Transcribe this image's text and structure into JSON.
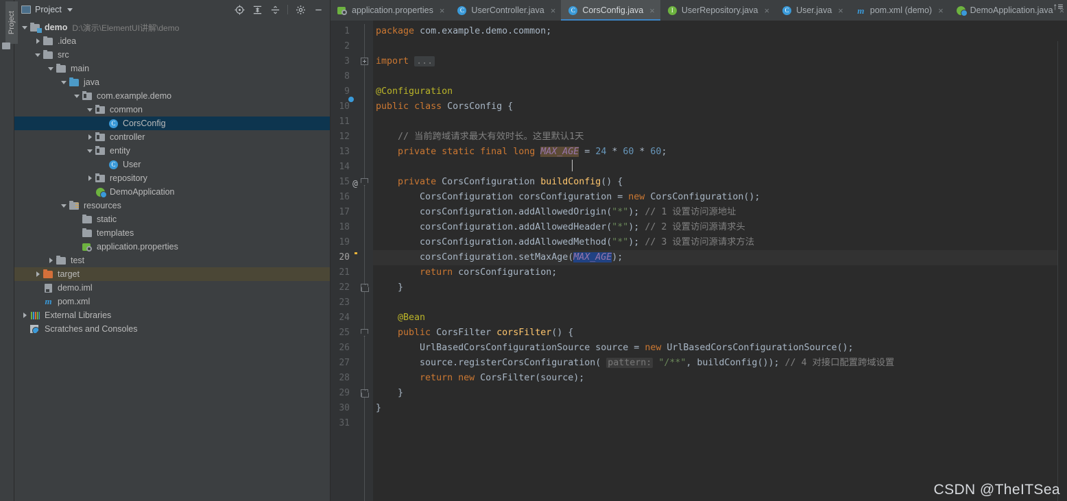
{
  "tool_strip": {
    "label": "Project"
  },
  "project_panel": {
    "title": "Project",
    "actions": [
      {
        "name": "locate-icon",
        "glyph": "⊕"
      },
      {
        "name": "expand-all-icon",
        "glyph": "≡"
      },
      {
        "name": "collapse-all-icon",
        "glyph": "≡"
      },
      {
        "name": "settings-gear-icon",
        "glyph": "⚙"
      },
      {
        "name": "minimize-icon",
        "glyph": "—"
      }
    ],
    "tree": [
      {
        "label": "demo",
        "path": "D:\\演示\\ElementUI讲解\\demo",
        "indent": 0,
        "arrow": "down",
        "icon": "module",
        "bold": true
      },
      {
        "label": ".idea",
        "indent": 1,
        "arrow": "right",
        "icon": "folder"
      },
      {
        "label": "src",
        "indent": 1,
        "arrow": "down",
        "icon": "folder"
      },
      {
        "label": "main",
        "indent": 2,
        "arrow": "down",
        "icon": "folder"
      },
      {
        "label": "java",
        "indent": 3,
        "arrow": "down",
        "icon": "folder-src"
      },
      {
        "label": "com.example.demo",
        "indent": 4,
        "arrow": "down",
        "icon": "package"
      },
      {
        "label": "common",
        "indent": 5,
        "arrow": "down",
        "icon": "package"
      },
      {
        "label": "CorsConfig",
        "indent": 6,
        "arrow": "none",
        "icon": "class",
        "selected": true
      },
      {
        "label": "controller",
        "indent": 5,
        "arrow": "right",
        "icon": "package"
      },
      {
        "label": "entity",
        "indent": 5,
        "arrow": "down",
        "icon": "package"
      },
      {
        "label": "User",
        "indent": 6,
        "arrow": "none",
        "icon": "class"
      },
      {
        "label": "repository",
        "indent": 5,
        "arrow": "right",
        "icon": "package"
      },
      {
        "label": "DemoApplication",
        "indent": 5,
        "arrow": "none",
        "icon": "spring-app"
      },
      {
        "label": "resources",
        "indent": 3,
        "arrow": "down",
        "icon": "folder-res"
      },
      {
        "label": "static",
        "indent": 4,
        "arrow": "none",
        "icon": "folder"
      },
      {
        "label": "templates",
        "indent": 4,
        "arrow": "none",
        "icon": "folder"
      },
      {
        "label": "application.properties",
        "indent": 4,
        "arrow": "none",
        "icon": "properties"
      },
      {
        "label": "test",
        "indent": 2,
        "arrow": "right",
        "icon": "folder"
      },
      {
        "label": "target",
        "indent": 1,
        "arrow": "right",
        "icon": "folder-target",
        "highlight": true
      },
      {
        "label": "demo.iml",
        "indent": 1,
        "arrow": "none",
        "icon": "iml"
      },
      {
        "label": "pom.xml",
        "indent": 1,
        "arrow": "none",
        "icon": "maven"
      },
      {
        "label": "External Libraries",
        "indent": 0,
        "arrow": "right",
        "icon": "libraries"
      },
      {
        "label": "Scratches and Consoles",
        "indent": 0,
        "arrow": "none",
        "icon": "scratches"
      }
    ]
  },
  "editor": {
    "tabs": [
      {
        "label": "application.properties",
        "icon": "properties-icon",
        "active": false,
        "close": "×"
      },
      {
        "label": "UserController.java",
        "icon": "class-icon",
        "active": false,
        "close": "×"
      },
      {
        "label": "CorsConfig.java",
        "icon": "class-icon",
        "active": true,
        "close": "×"
      },
      {
        "label": "UserRepository.java",
        "icon": "interface-icon",
        "active": false,
        "close": "×"
      },
      {
        "label": "User.java",
        "icon": "class-icon",
        "active": false,
        "close": "×"
      },
      {
        "label": "pom.xml (demo)",
        "icon": "maven-icon",
        "active": false,
        "close": "×"
      },
      {
        "label": "DemoApplication.java",
        "icon": "spring-icon",
        "active": false,
        "close": "×"
      }
    ],
    "tabbar_overflow": "↑≡",
    "current_line": 20,
    "lines": [
      {
        "n": "1",
        "gutter": "",
        "fold": "",
        "html": "<span class=\"kw\">package</span> <span class=\"id\">com.example.demo.common</span><span class=\"id\">;</span>"
      },
      {
        "n": "2",
        "gutter": "",
        "fold": "",
        "html": ""
      },
      {
        "n": "3",
        "gutter": "",
        "fold": "plus",
        "html": "<span class=\"kw\">import</span> <span class=\"fold-dots\">...</span>"
      },
      {
        "n": "8",
        "gutter": "",
        "fold": "",
        "html": ""
      },
      {
        "n": "9",
        "gutter": "",
        "fold": "",
        "html": "<span class=\"ann\">@Configuration</span>"
      },
      {
        "n": "10",
        "gutter": "spring",
        "fold": "",
        "html": "<span class=\"kw\">public</span> <span class=\"kw\">class</span> <span class=\"id\">CorsConfig</span> {"
      },
      {
        "n": "11",
        "gutter": "",
        "fold": "",
        "html": ""
      },
      {
        "n": "12",
        "gutter": "",
        "fold": "",
        "html": "    <span class=\"cmt\">// 当前跨域请求最大有效时长。这里默认1天</span>"
      },
      {
        "n": "13",
        "gutter": "",
        "fold": "",
        "html": "    <span class=\"kw\">private</span> <span class=\"kw\">static</span> <span class=\"kw\">final</span> <span class=\"kw\">long</span> <span class=\"const-mark\">MAX_AGE</span> = <span class=\"num2\">24</span> * <span class=\"num2\">60</span> * <span class=\"num2\">60</span>;"
      },
      {
        "n": "14",
        "gutter": "",
        "fold": "",
        "html": ""
      },
      {
        "n": "15",
        "gutter": "at",
        "fold": "tri-down",
        "html": "    <span class=\"kw\">private</span> <span class=\"id\">CorsConfiguration</span> <span class=\"fn\">buildConfig</span>() {"
      },
      {
        "n": "16",
        "gutter": "",
        "fold": "",
        "html": "        <span class=\"id\">CorsConfiguration</span> <span class=\"id\">corsConfiguration</span> = <span class=\"kw\">new</span> <span class=\"id\">CorsConfiguration</span>();"
      },
      {
        "n": "17",
        "gutter": "",
        "fold": "",
        "html": "        <span class=\"id\">corsConfiguration</span>.<span class=\"id\">addAllowedOrigin</span>(<span class=\"str\">\"*\"</span>); <span class=\"cmt\">// 1 设置访问源地址</span>"
      },
      {
        "n": "18",
        "gutter": "",
        "fold": "",
        "html": "        <span class=\"id\">corsConfiguration</span>.<span class=\"id\">addAllowedHeader</span>(<span class=\"str\">\"*\"</span>); <span class=\"cmt\">// 2 设置访问源请求头</span>"
      },
      {
        "n": "19",
        "gutter": "",
        "fold": "",
        "html": "        <span class=\"id\">corsConfiguration</span>.<span class=\"id\">addAllowedMethod</span>(<span class=\"str\">\"*\"</span>); <span class=\"cmt\">// 3 设置访问源请求方法</span>"
      },
      {
        "n": "20",
        "gutter": "bulb",
        "fold": "",
        "html": "        <span class=\"id\">corsConfiguration</span>.<span class=\"id\">setMaxAge</span>(<span class=\"const-hl\">MAX_AGE</span>);",
        "current": true
      },
      {
        "n": "21",
        "gutter": "",
        "fold": "",
        "html": "        <span class=\"kw\">return</span> <span class=\"id\">corsConfiguration</span>;"
      },
      {
        "n": "22",
        "gutter": "",
        "fold": "tri-up",
        "html": "    }"
      },
      {
        "n": "23",
        "gutter": "",
        "fold": "",
        "html": ""
      },
      {
        "n": "24",
        "gutter": "bean",
        "fold": "",
        "html": "    <span class=\"ann\">@Bean</span>"
      },
      {
        "n": "25",
        "gutter": "",
        "fold": "tri-down",
        "html": "    <span class=\"kw\">public</span> <span class=\"id\">CorsFilter</span> <span class=\"fn\">corsFilter</span>() {"
      },
      {
        "n": "26",
        "gutter": "",
        "fold": "",
        "html": "        <span class=\"id\">UrlBasedCorsConfigurationSource</span> <span class=\"id\">source</span> = <span class=\"kw\">new</span> <span class=\"id\">UrlBasedCorsConfigurationSource</span>();"
      },
      {
        "n": "27",
        "gutter": "",
        "fold": "",
        "html": "        <span class=\"id\">source</span>.<span class=\"id\">registerCorsConfiguration</span>( <span class=\"hint\">pattern:</span> <span class=\"str\">\"/**\"</span>, <span class=\"id\">buildConfig</span>()); <span class=\"cmt\">// 4 对接口配置跨域设置</span>"
      },
      {
        "n": "28",
        "gutter": "",
        "fold": "",
        "html": "        <span class=\"kw\">return</span> <span class=\"kw\">new</span> <span class=\"id\">CorsFilter</span>(<span class=\"id\">source</span>);"
      },
      {
        "n": "29",
        "gutter": "",
        "fold": "tri-up",
        "html": "    }"
      },
      {
        "n": "30",
        "gutter": "",
        "fold": "",
        "html": "}"
      },
      {
        "n": "31",
        "gutter": "",
        "fold": "",
        "html": ""
      }
    ]
  },
  "watermark": {
    "text": "CSDN @TheITSea"
  },
  "colors": {
    "panel_bg": "#3c3f41",
    "editor_bg": "#2b2b2b",
    "gutter_bg": "#313335",
    "selection_blue": "#0d354f",
    "tab_active": "#4e5254",
    "tab_underline": "#3d85c6",
    "keyword": "#cc7832",
    "string": "#6a8759",
    "number": "#6897bb",
    "annotation": "#bbb529",
    "comment": "#808080",
    "identifier": "#a9b7c6",
    "method": "#ffc66d",
    "constant": "#9876aa"
  }
}
